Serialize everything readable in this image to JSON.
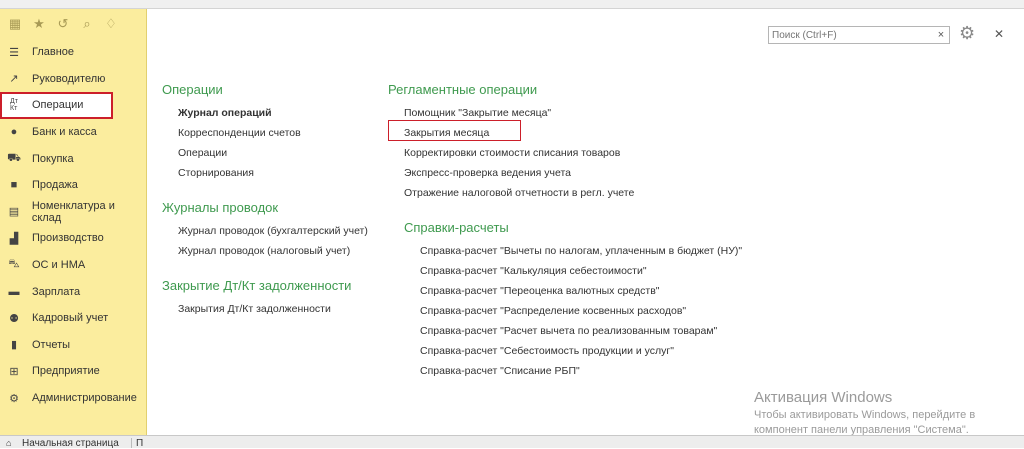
{
  "sidebar": {
    "toolbar_icons": [
      "apps-grid-icon",
      "star-icon",
      "history-icon",
      "search-icon",
      "bell-icon"
    ],
    "items": [
      {
        "label": "Главное",
        "icon": "menu-lines-icon"
      },
      {
        "label": "Руководителю",
        "icon": "trend-icon"
      },
      {
        "label": "Операции",
        "icon": "dt-kt-icon",
        "active": true
      },
      {
        "label": "Банк и касса",
        "icon": "coin-icon"
      },
      {
        "label": "Покупка",
        "icon": "cart-icon"
      },
      {
        "label": "Продажа",
        "icon": "bag-icon"
      },
      {
        "label": "Номенклатура и склад",
        "icon": "warehouse-icon"
      },
      {
        "label": "Производство",
        "icon": "factory-icon"
      },
      {
        "label": "ОС и НМА",
        "icon": "truck-icon"
      },
      {
        "label": "Зарплата",
        "icon": "wallet-icon"
      },
      {
        "label": "Кадровый учет",
        "icon": "people-icon"
      },
      {
        "label": "Отчеты",
        "icon": "bar-chart-icon"
      },
      {
        "label": "Предприятие",
        "icon": "branch-icon"
      },
      {
        "label": "Администрирование",
        "icon": "gear-icon"
      }
    ]
  },
  "search": {
    "placeholder": "Поиск (Ctrl+F)"
  },
  "sections": {
    "operations": {
      "title": "Операции",
      "links": [
        "Журнал операций",
        "Корреспонденции счетов",
        "Операции",
        "Сторнирования"
      ]
    },
    "journals": {
      "title": "Журналы проводок",
      "links": [
        "Журнал проводок (бухгалтерский учет)",
        "Журнал проводок (налоговый учет)"
      ]
    },
    "closing_debts": {
      "title": "Закрытие Дт/Кт задолженности",
      "links": [
        "Закрытия Дт/Кт задолженности"
      ]
    },
    "regulated": {
      "title": "Регламентные операции",
      "links": [
        "Помощник \"Закрытие месяца\"",
        "Закрытия месяца",
        "Корректировки стоимости списания товаров",
        "Экспресс-проверка ведения учета",
        "Отражение налоговой отчетности в регл. учете"
      ]
    },
    "calculations": {
      "title": "Справки-расчеты",
      "links": [
        "Справка-расчет \"Вычеты по налогам, уплаченным в бюджет (НУ)\"",
        "Справка-расчет \"Калькуляция себестоимости\"",
        "Справка-расчет \"Переоценка валютных средств\"",
        "Справка-расчет \"Распределение косвенных расходов\"",
        "Справка-расчет \"Расчет вычета  по реализованным товарам\"",
        "Справка-расчет \"Себестоимость продукции и услуг\"",
        "Справка-расчет \"Списание РБП\""
      ]
    }
  },
  "watermark": {
    "title": "Активация Windows",
    "line1": "Чтобы активировать Windows, перейдите в",
    "line2": "компонент панели управления \"Система\"."
  },
  "bottom_tabs": [
    "Начальная страница",
    "П"
  ]
}
